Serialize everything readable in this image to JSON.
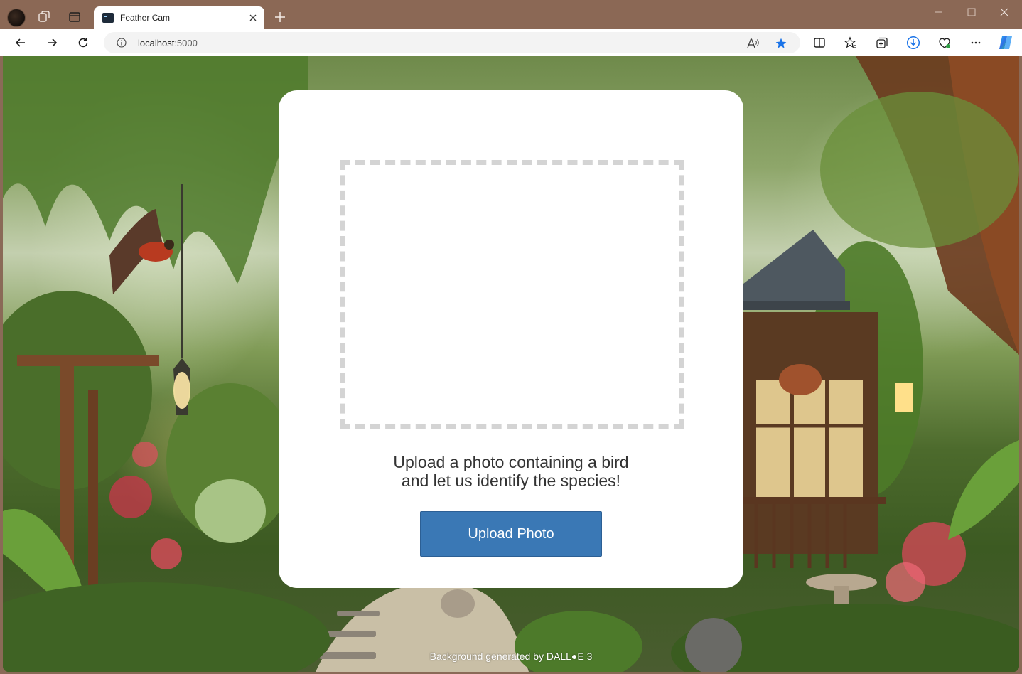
{
  "browser": {
    "tab": {
      "title": "Feather Cam"
    },
    "address": {
      "host": "localhost",
      "port": ":5000"
    }
  },
  "page": {
    "prompt_line1": "Upload a photo containing a bird",
    "prompt_line2": "and let us identify the species!",
    "upload_button": "Upload Photo",
    "credit": "Background generated by DALL●E 3"
  },
  "colors": {
    "titlebar": "#8b6855",
    "button_blue": "#3a78b5",
    "dashed_border": "#d4d4d4",
    "card_bg": "#ffffff"
  }
}
